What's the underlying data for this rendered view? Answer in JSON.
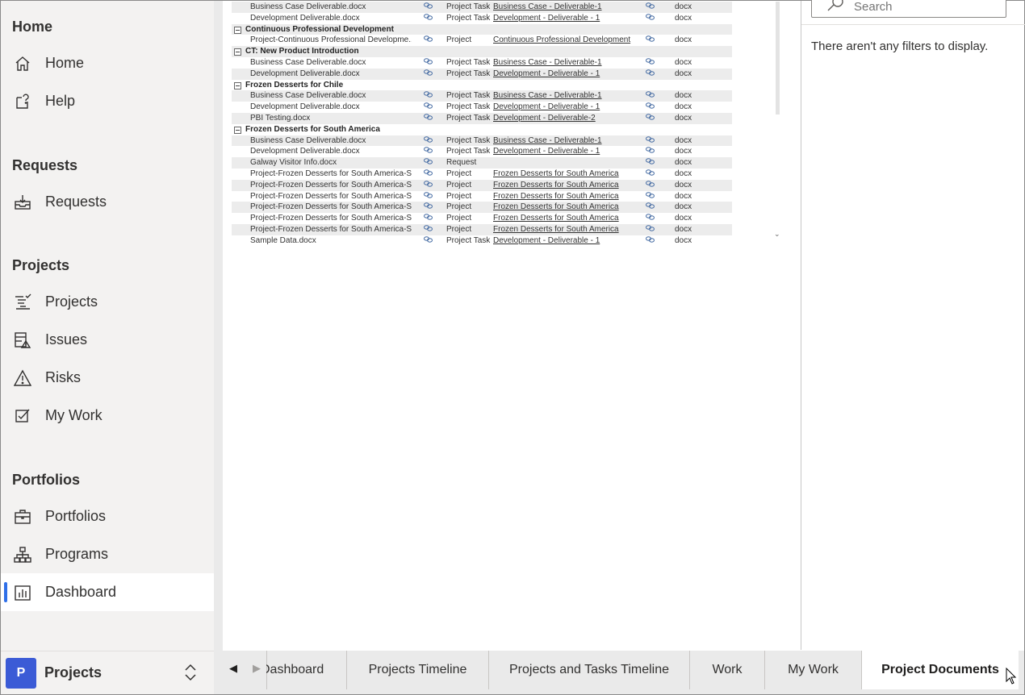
{
  "sidebar": {
    "groups": [
      {
        "title": "Home",
        "items": [
          {
            "label": "Home",
            "icon": "home-icon"
          },
          {
            "label": "Help",
            "icon": "help-icon"
          }
        ]
      },
      {
        "title": "Requests",
        "items": [
          {
            "label": "Requests",
            "icon": "inbox-icon"
          }
        ]
      },
      {
        "title": "Projects",
        "items": [
          {
            "label": "Projects",
            "icon": "task-list-icon"
          },
          {
            "label": "Issues",
            "icon": "issues-icon"
          },
          {
            "label": "Risks",
            "icon": "warning-icon"
          },
          {
            "label": "My Work",
            "icon": "checkbox-icon"
          }
        ]
      },
      {
        "title": "Portfolios",
        "items": [
          {
            "label": "Portfolios",
            "icon": "briefcase-icon"
          },
          {
            "label": "Programs",
            "icon": "org-chart-icon"
          },
          {
            "label": "Dashboard",
            "icon": "power-bi-icon",
            "active": true
          }
        ]
      }
    ],
    "footer": {
      "avatar_letter": "P",
      "label": "Projects"
    }
  },
  "table": {
    "rows": [
      {
        "kind": "item",
        "name": "Business Case Deliverable.docx",
        "type": "Project Task",
        "parent": "Business Case - Deliverable-1",
        "ext": "docx",
        "shade": true
      },
      {
        "kind": "item",
        "name": "Development Deliverable.docx",
        "type": "Project Task",
        "parent": "Development - Deliverable - 1",
        "ext": "docx",
        "shade": false
      },
      {
        "kind": "group",
        "name": "Continuous Professional Development",
        "shade": true
      },
      {
        "kind": "item",
        "name": "Project-Continuous Professional Developme...",
        "type": "Project",
        "parent": "Continuous Professional Development",
        "ext": "docx",
        "shade": false
      },
      {
        "kind": "group",
        "name": "CT: New Product Introduction",
        "shade": true
      },
      {
        "kind": "item",
        "name": "Business Case Deliverable.docx",
        "type": "Project Task",
        "parent": "Business Case - Deliverable-1",
        "ext": "docx",
        "shade": false
      },
      {
        "kind": "item",
        "name": "Development Deliverable.docx",
        "type": "Project Task",
        "parent": "Development - Deliverable - 1",
        "ext": "docx",
        "shade": true
      },
      {
        "kind": "group",
        "name": "Frozen Desserts for Chile",
        "shade": false
      },
      {
        "kind": "item",
        "name": "Business Case Deliverable.docx",
        "type": "Project Task",
        "parent": "Business Case - Deliverable-1",
        "ext": "docx",
        "shade": true
      },
      {
        "kind": "item",
        "name": "Development Deliverable.docx",
        "type": "Project Task",
        "parent": "Development - Deliverable - 1",
        "ext": "docx",
        "shade": false
      },
      {
        "kind": "item",
        "name": "PBI Testing.docx",
        "type": "Project Task",
        "parent": "Development - Deliverable-2",
        "ext": "docx",
        "shade": true
      },
      {
        "kind": "group",
        "name": "Frozen Desserts for South America",
        "shade": false
      },
      {
        "kind": "item",
        "name": "Business Case Deliverable.docx",
        "type": "Project Task",
        "parent": "Business Case - Deliverable-1",
        "ext": "docx",
        "shade": true
      },
      {
        "kind": "item",
        "name": "Development Deliverable.docx",
        "type": "Project Task",
        "parent": "Development - Deliverable - 1",
        "ext": "docx",
        "shade": false
      },
      {
        "kind": "item",
        "name": "Galway Visitor Info.docx",
        "type": "Request",
        "parent": "",
        "ext": "docx",
        "shade": true
      },
      {
        "kind": "item",
        "name": "Project-Frozen Desserts for South America-S...",
        "type": "Project",
        "parent": "Frozen Desserts for South America",
        "ext": "docx",
        "shade": false
      },
      {
        "kind": "item",
        "name": "Project-Frozen Desserts for South America-S...",
        "type": "Project",
        "parent": "Frozen Desserts for South America",
        "ext": "docx",
        "shade": true
      },
      {
        "kind": "item",
        "name": "Project-Frozen Desserts for South America-S...",
        "type": "Project",
        "parent": "Frozen Desserts for South America",
        "ext": "docx",
        "shade": false
      },
      {
        "kind": "item",
        "name": "Project-Frozen Desserts for South America-S...",
        "type": "Project",
        "parent": "Frozen Desserts for South America",
        "ext": "docx",
        "shade": true
      },
      {
        "kind": "item",
        "name": "Project-Frozen Desserts for South America-S...",
        "type": "Project",
        "parent": "Frozen Desserts for South America",
        "ext": "docx",
        "shade": false
      },
      {
        "kind": "item",
        "name": "Project-Frozen Desserts for South America-S...",
        "type": "Project",
        "parent": "Frozen Desserts for South America",
        "ext": "docx",
        "shade": true
      },
      {
        "kind": "item",
        "name": "Sample Data.docx",
        "type": "Project Task",
        "parent": "Development - Deliverable - 1",
        "ext": "docx",
        "shade": false
      }
    ]
  },
  "filters": {
    "search_placeholder": "Search",
    "empty_message": "There aren't any filters to display."
  },
  "tabs": {
    "items": [
      {
        "label": "Dashboard"
      },
      {
        "label": "Projects Timeline"
      },
      {
        "label": "Projects and Tasks Timeline"
      },
      {
        "label": "Work"
      },
      {
        "label": "My Work"
      },
      {
        "label": "Project Documents",
        "active": true
      }
    ]
  },
  "colors": {
    "accent_nav": "#2f6fe8",
    "avatar_bg": "#3b5bd6",
    "active_tab_underline": "#f2c811"
  }
}
